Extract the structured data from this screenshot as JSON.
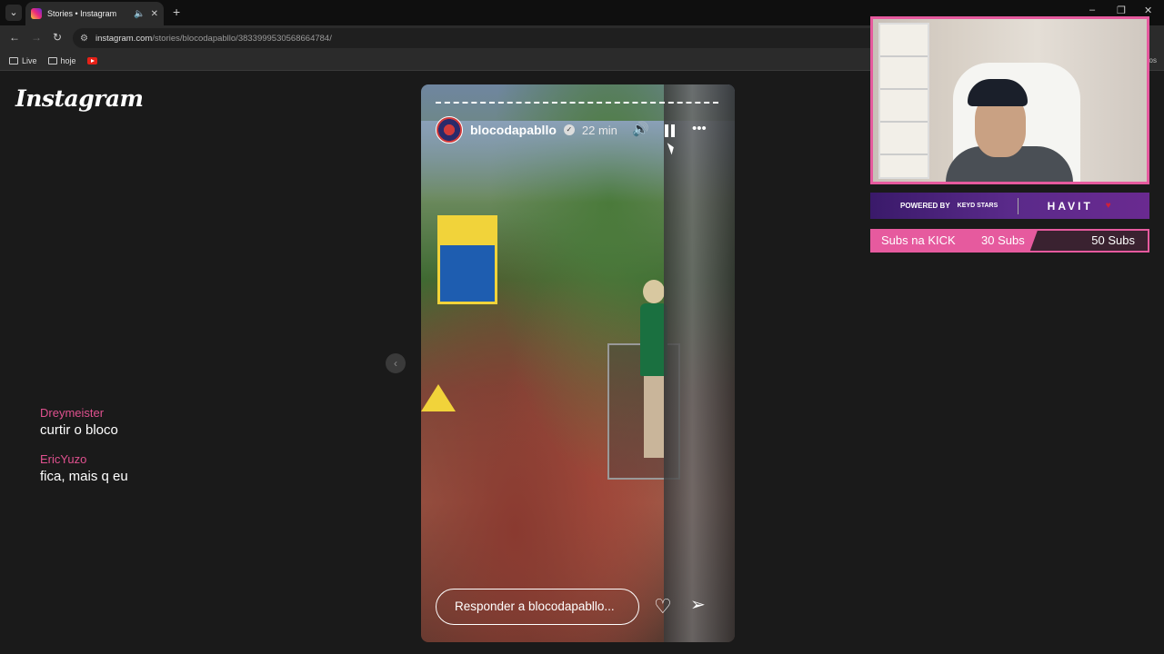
{
  "browser": {
    "tab_title": "Stories • Instagram",
    "new_tab": "+",
    "url_host": "instagram.com",
    "url_path": "/stories/blocodapabllo/3833999530568664784/",
    "bookmarks": [
      {
        "label": "Live"
      },
      {
        "label": "hoje"
      }
    ],
    "bookmarks_right": "os"
  },
  "instagram": {
    "logo": "Instagram"
  },
  "chat": [
    {
      "user": "Dreymeister",
      "text": "curtir o bloco"
    },
    {
      "user": "EricYuzo",
      "text": "fica, mais q eu"
    }
  ],
  "story": {
    "username": "blocodapabllo",
    "time": "22 min",
    "reply_placeholder": "Responder a blocodapabllo...",
    "verified_mark": "✓",
    "mute_symbol": "🔊",
    "more_symbol": "•••",
    "heart_symbol": "♡",
    "send_symbol": "➢",
    "prev_symbol": "‹"
  },
  "overlay": {
    "powered_by": "POWERED BY",
    "keyd": "KEYD STARS",
    "havit": "HAVIT",
    "havit_mark": "♥",
    "goal_label": "Subs na KICK",
    "goal_current": "30 Subs",
    "goal_target": "50 Subs",
    "goal_fraction": 0.6
  },
  "colors": {
    "accent_pink": "#e65a9e",
    "sponsor_purple": "#5a2a8a"
  }
}
